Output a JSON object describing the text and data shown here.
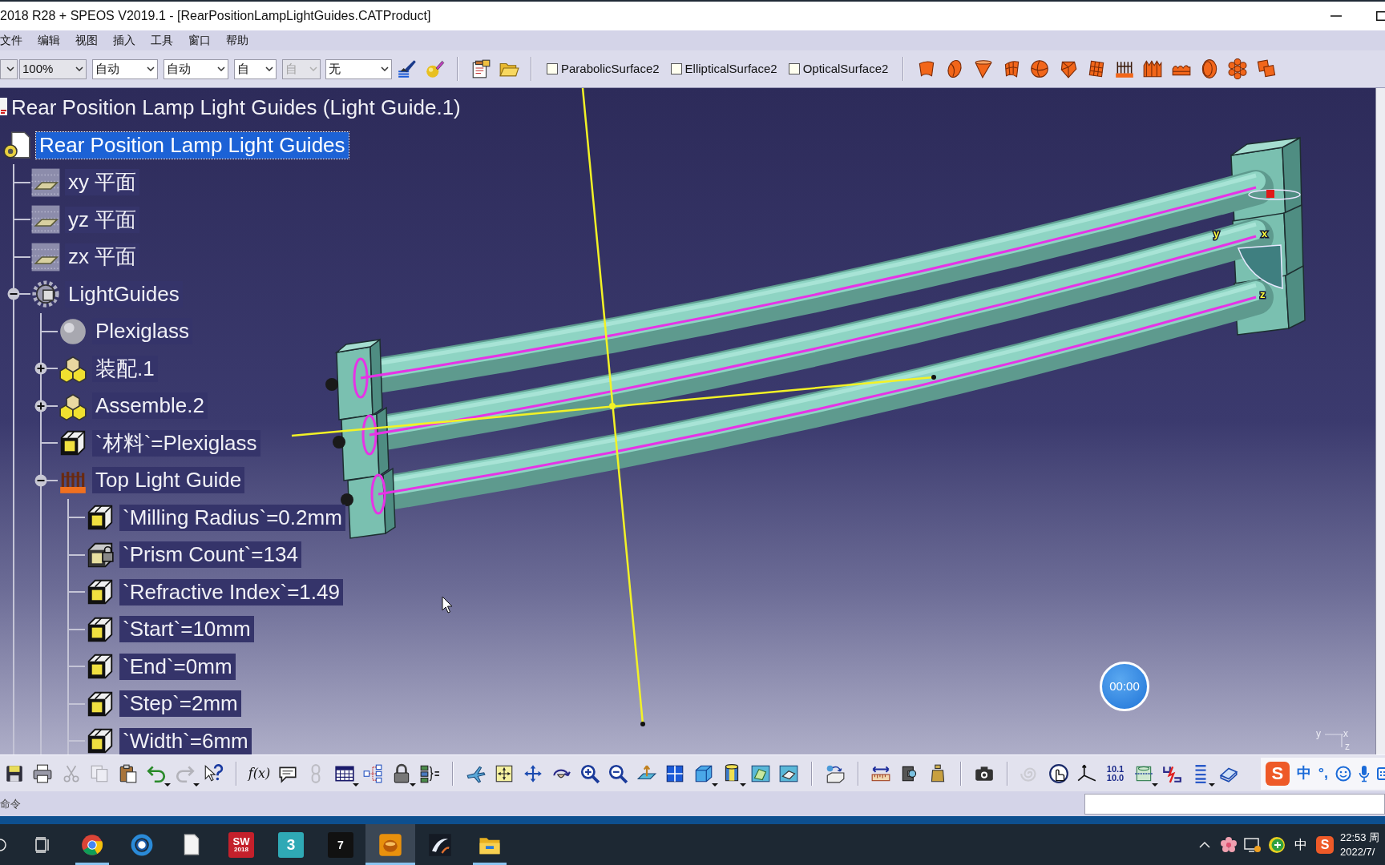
{
  "window": {
    "title": "2018 R28 + SPEOS V2019.1 - [RearPositionLampLightGuides.CATProduct]"
  },
  "menu": [
    "文件",
    "编辑",
    "视图",
    "插入",
    "工具",
    "窗口",
    "帮助"
  ],
  "top_toolbar": {
    "combos": [
      {
        "kind": "list",
        "disabled": false
      },
      {
        "kind": "list",
        "value": "100%",
        "disabled": false
      },
      {
        "kind": "edit",
        "value": "自动",
        "disabled": false
      },
      {
        "kind": "edit",
        "value": "自动",
        "disabled": false
      },
      {
        "kind": "edit",
        "value": "自",
        "disabled": false
      },
      {
        "kind": "list",
        "value": "自",
        "disabled": true
      },
      {
        "kind": "edit",
        "value": "无",
        "disabled": false
      }
    ],
    "tools": [
      {
        "kind": "brush"
      },
      {
        "kind": "material"
      },
      {
        "kind": "separator"
      },
      {
        "kind": "properties"
      },
      {
        "kind": "folder"
      },
      {
        "kind": "separator"
      }
    ],
    "checkboxes": [
      {
        "label": "ParabolicSurface2",
        "checked": false
      },
      {
        "label": "EllipticalSurface2",
        "checked": false
      },
      {
        "label": "OpticalSurface2",
        "checked": false
      }
    ],
    "surfaces": [
      {
        "kind": "patch"
      },
      {
        "kind": "ellipsoid"
      },
      {
        "kind": "cone"
      },
      {
        "kind": "curved-grid"
      },
      {
        "kind": "sphere"
      },
      {
        "kind": "faceted"
      },
      {
        "kind": "tile"
      },
      {
        "kind": "comb"
      },
      {
        "kind": "ridges"
      },
      {
        "kind": "wave"
      },
      {
        "kind": "disc"
      },
      {
        "kind": "cluster"
      },
      {
        "kind": "squares"
      }
    ]
  },
  "tree": {
    "header": "Rear Position Lamp Light Guides (Light Guide.1)",
    "root": {
      "label": "Rear Position Lamp Light Guides",
      "kind": "product",
      "selected": true,
      "children": [
        {
          "label": "xy 平面",
          "kind": "plane",
          "selected": false
        },
        {
          "label": "yz 平面",
          "kind": "plane",
          "selected": false
        },
        {
          "label": "zx 平面",
          "kind": "plane",
          "selected": false
        },
        {
          "label": "LightGuides",
          "kind": "body",
          "selected": false,
          "expanded": true,
          "children": [
            {
              "label": "Plexiglass",
              "kind": "material",
              "selected": false
            },
            {
              "label": "装配.1",
              "kind": "assembly",
              "selected": false,
              "expanded": false
            },
            {
              "label": "Assemble.2",
              "kind": "assembly",
              "selected": false,
              "expanded": false
            },
            {
              "label": "`材料`=Plexiglass",
              "kind": "parameter",
              "selected": false
            },
            {
              "label": "Top Light Guide",
              "kind": "light-guide",
              "selected": false,
              "expanded": true,
              "children": [
                {
                  "label": "`Milling Radius`=0.2mm",
                  "kind": "parameter",
                  "selected": false
                },
                {
                  "label": "`Prism Count`=134",
                  "kind": "parameter-locked",
                  "selected": false
                },
                {
                  "label": "`Refractive Index`=1.49",
                  "kind": "parameter",
                  "selected": false
                },
                {
                  "label": "`Start`=10mm",
                  "kind": "parameter",
                  "selected": false
                },
                {
                  "label": "`End`=0mm",
                  "kind": "parameter",
                  "selected": false
                },
                {
                  "label": "`Step`=2mm",
                  "kind": "parameter",
                  "selected": false
                },
                {
                  "label": "`Width`=6mm",
                  "kind": "parameter",
                  "selected": false
                }
              ]
            }
          ]
        }
      ]
    }
  },
  "viewport": {
    "timer": "00:00",
    "model_axis_labels": [
      "y",
      "x",
      "z"
    ],
    "compass_labels": [
      "y",
      "x",
      "z"
    ]
  },
  "bottom_toolbar": [
    {
      "kind": "save",
      "disabled": false
    },
    {
      "kind": "print",
      "disabled": false
    },
    {
      "kind": "cut",
      "disabled": true
    },
    {
      "kind": "copy",
      "disabled": true
    },
    {
      "kind": "paste",
      "disabled": false
    },
    {
      "kind": "undo",
      "disabled": false,
      "menu": true
    },
    {
      "kind": "redo",
      "disabled": true,
      "menu": true
    },
    {
      "kind": "help",
      "disabled": false
    },
    {
      "kind": "separator"
    },
    {
      "kind": "formula",
      "glyph": "f(x)",
      "disabled": false
    },
    {
      "kind": "comment",
      "disabled": false
    },
    {
      "kind": "chain",
      "disabled": true
    },
    {
      "kind": "table",
      "disabled": false,
      "menu": true
    },
    {
      "kind": "tree",
      "disabled": false
    },
    {
      "kind": "lock",
      "disabled": false,
      "menu": true
    },
    {
      "kind": "equations",
      "disabled": false
    },
    {
      "kind": "separator"
    },
    {
      "kind": "fly",
      "disabled": false
    },
    {
      "kind": "fit",
      "disabled": false
    },
    {
      "kind": "pan",
      "disabled": false
    },
    {
      "kind": "rotate",
      "disabled": false
    },
    {
      "kind": "zoom-in",
      "disabled": false
    },
    {
      "kind": "zoom-out",
      "disabled": false
    },
    {
      "kind": "normal",
      "disabled": false
    },
    {
      "kind": "quad",
      "disabled": false
    },
    {
      "kind": "iso",
      "disabled": false,
      "menu": true
    },
    {
      "kind": "shading",
      "disabled": false,
      "menu": true
    },
    {
      "kind": "hide-show",
      "disabled": false
    },
    {
      "kind": "swap",
      "disabled": false
    },
    {
      "kind": "separator"
    },
    {
      "kind": "assembly",
      "disabled": false
    },
    {
      "kind": "separator"
    },
    {
      "kind": "measure",
      "disabled": false
    },
    {
      "kind": "inertia",
      "disabled": false
    },
    {
      "kind": "weight",
      "disabled": false
    },
    {
      "kind": "separator"
    },
    {
      "kind": "camera",
      "disabled": false
    },
    {
      "kind": "separator"
    },
    {
      "kind": "swirl",
      "disabled": true
    },
    {
      "kind": "hand-globe",
      "disabled": false
    },
    {
      "kind": "axes",
      "disabled": false
    },
    {
      "kind": "units",
      "lines": [
        "10.1",
        "10.0"
      ],
      "disabled": false
    },
    {
      "kind": "frame",
      "disabled": false,
      "menu": true
    },
    {
      "kind": "wire",
      "disabled": false
    },
    {
      "kind": "list",
      "disabled": false,
      "menu": true
    },
    {
      "kind": "book",
      "disabled": false
    }
  ],
  "ime_bar": {
    "logo": "S",
    "mode": "中",
    "punctuation": "°,"
  },
  "status_bar": {
    "prompt": "命令"
  },
  "taskbar": {
    "apps": [
      {
        "kind": "browser",
        "running": true,
        "selected": false
      },
      {
        "kind": "ring",
        "running": false,
        "selected": false
      },
      {
        "kind": "document",
        "running": false,
        "selected": false
      },
      {
        "kind": "red-tile",
        "lines": [
          "SW",
          "2018"
        ],
        "running": false,
        "selected": false
      },
      {
        "kind": "teal-tile",
        "lines": [
          "3"
        ],
        "running": false,
        "selected": false
      },
      {
        "kind": "black-tile",
        "lines": [
          "7"
        ],
        "running": false,
        "selected": false
      },
      {
        "kind": "orange-app",
        "running": true,
        "selected": true
      },
      {
        "kind": "dark-app",
        "running": false,
        "selected": false
      },
      {
        "kind": "folder",
        "running": true,
        "selected": false
      }
    ],
    "tray": [
      {
        "kind": "chevron"
      },
      {
        "kind": "flower"
      },
      {
        "kind": "monitor"
      },
      {
        "kind": "plus"
      },
      {
        "kind": "text",
        "glyph": "中"
      },
      {
        "kind": "logo",
        "glyph": "S"
      }
    ],
    "clock": {
      "time": "22:53 周",
      "date": "2022/7/"
    }
  }
}
